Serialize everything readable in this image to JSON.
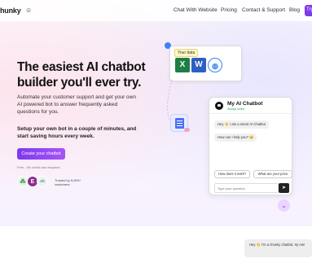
{
  "nav": {
    "logo": "hunky",
    "links": [
      "Chat With Website",
      "Pricing",
      "Contact & Support",
      "Blog"
    ],
    "cta": "Try"
  },
  "hero": {
    "headline": "The easiest AI chatbot builder you'll ever try.",
    "sub": "Automate your customer support and get your own AI powered bot to answer frequently asked questions for you.",
    "sub2": "Setup your own bot in a couple of minutes, and start saving hours every week.",
    "cta": "Create your chatbot",
    "free_note": "Free - No credit card required",
    "trusted": "Trusted by 5,000+ customers"
  },
  "data_card": {
    "tag": "Your data",
    "icons": [
      "excel-icon",
      "word-icon",
      "globe-icon"
    ]
  },
  "chat": {
    "title": "My AI Chatbot",
    "status": "Always online",
    "messages": [
      "Hey 👋 I am a smart AI Chatbot",
      "How can I help you? 😊"
    ],
    "quick_replies": [
      "How does it work?",
      "What are your price"
    ],
    "input_placeholder": "Type your question"
  },
  "float_bubble": "Hey 👋 I'm a chunky chatbot, try me!",
  "colors": {
    "accent": "#7c3aed",
    "accent_light": "#a855f7"
  }
}
